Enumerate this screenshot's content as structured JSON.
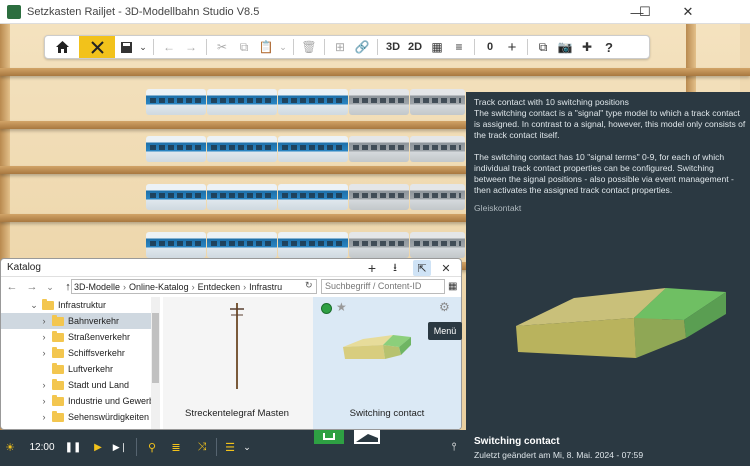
{
  "window": {
    "title": "Setzkasten Railjet - 3D-Modellbahn Studio V8.5",
    "minimize": "—",
    "maximize": "☐",
    "close": "✕"
  },
  "toolbar": {
    "view_3d": "3D",
    "view_2d": "2D",
    "counter": "0",
    "help": "?"
  },
  "info_panel": {
    "description": "Track contact with 10 switching positions\nThe switching contact is a \"signal\" type model to which a track contact is assigned. In contrast to a signal, however, this model only consists of the track contact itself.\n\nThe switching contact has 10 \"signal terms\" 0-9, for each of which individual track contact properties can be configured. Switching between the signal positions - also possible via event management - then activates the assigned track contact properties.",
    "category": "Gleiskontakt",
    "model_name": "Switching contact",
    "last_changed": "Zuletzt geändert am Mi, 8. Mai. 2024 - 07:59"
  },
  "catalog": {
    "title": "Katalog",
    "breadcrumb": [
      "3D-Modelle",
      "Online-Katalog",
      "Entdecken",
      "Infrastru"
    ],
    "search_placeholder": "Suchbegriff / Content-ID",
    "tree": [
      {
        "label": "Infrastruktur",
        "expanded": true,
        "level": 0
      },
      {
        "label": "Bahnverkehr",
        "expanded": false,
        "level": 1,
        "selected": true
      },
      {
        "label": "Straßenverkehr",
        "expanded": false,
        "level": 1
      },
      {
        "label": "Schiffsverkehr",
        "expanded": false,
        "level": 1
      },
      {
        "label": "Luftverkehr",
        "expanded": false,
        "level": 1
      },
      {
        "label": "Stadt und Land",
        "expanded": false,
        "level": 1
      },
      {
        "label": "Industrie und Gewerbe",
        "expanded": false,
        "level": 1
      },
      {
        "label": "Sehenswürdigkeiten",
        "expanded": false,
        "level": 1
      }
    ],
    "items": [
      {
        "label": "Streckentelegraf Masten"
      },
      {
        "label": "Switching contact"
      }
    ],
    "menu_tooltip": "Menü"
  },
  "statusbar": {
    "time": "12:00"
  },
  "colors": {
    "accent": "#f2c21b",
    "panel_bg": "#2b3942",
    "sim_green": "#2ea043"
  }
}
